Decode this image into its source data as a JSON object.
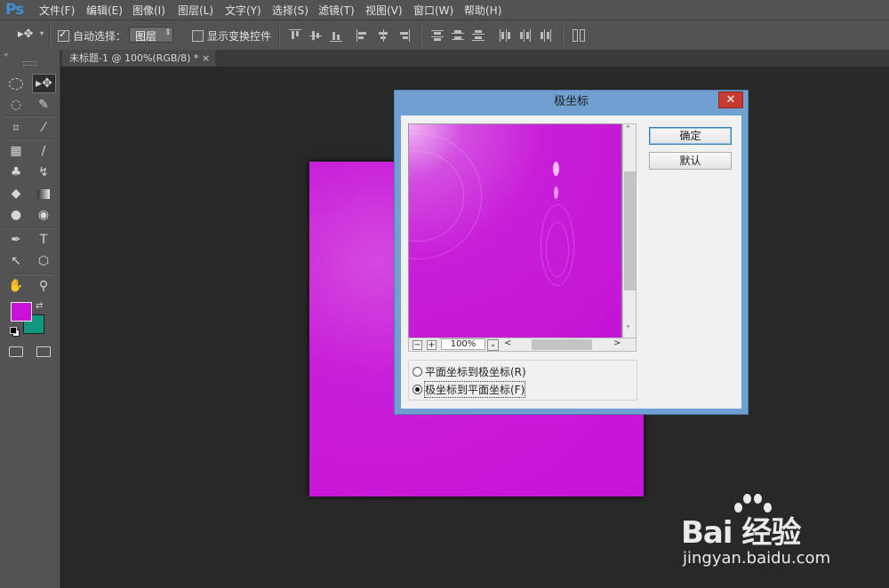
{
  "app": {
    "logo": "Ps"
  },
  "menu": [
    "文件(F)",
    "编辑(E)",
    "图像(I)",
    "图层(L)",
    "文字(Y)",
    "选择(S)",
    "滤镜(T)",
    "视图(V)",
    "窗口(W)",
    "帮助(H)"
  ],
  "options": {
    "auto_select_label": "自动选择：",
    "auto_select_value": "图层",
    "show_transform_label": "显示变换控件"
  },
  "document_tab": {
    "title": "未标题-1 @ 100%(RGB/8) *",
    "close": "×"
  },
  "colors": {
    "foreground": "#c812d8",
    "background": "#11977f",
    "accent": "#6fa0cf"
  },
  "dialog": {
    "title": "极坐标",
    "close": "✕",
    "ok_label": "确定",
    "default_label": "默认",
    "zoom_minus": "−",
    "zoom_plus": "+",
    "zoom_value": "100%",
    "options": [
      {
        "label": "平面坐标到极坐标(R)",
        "selected": false
      },
      {
        "label": "极坐标到平面坐标(F)",
        "selected": true
      }
    ]
  },
  "watermark": {
    "brand": "Bai  经验",
    "url": "jingyan.baidu.com"
  }
}
